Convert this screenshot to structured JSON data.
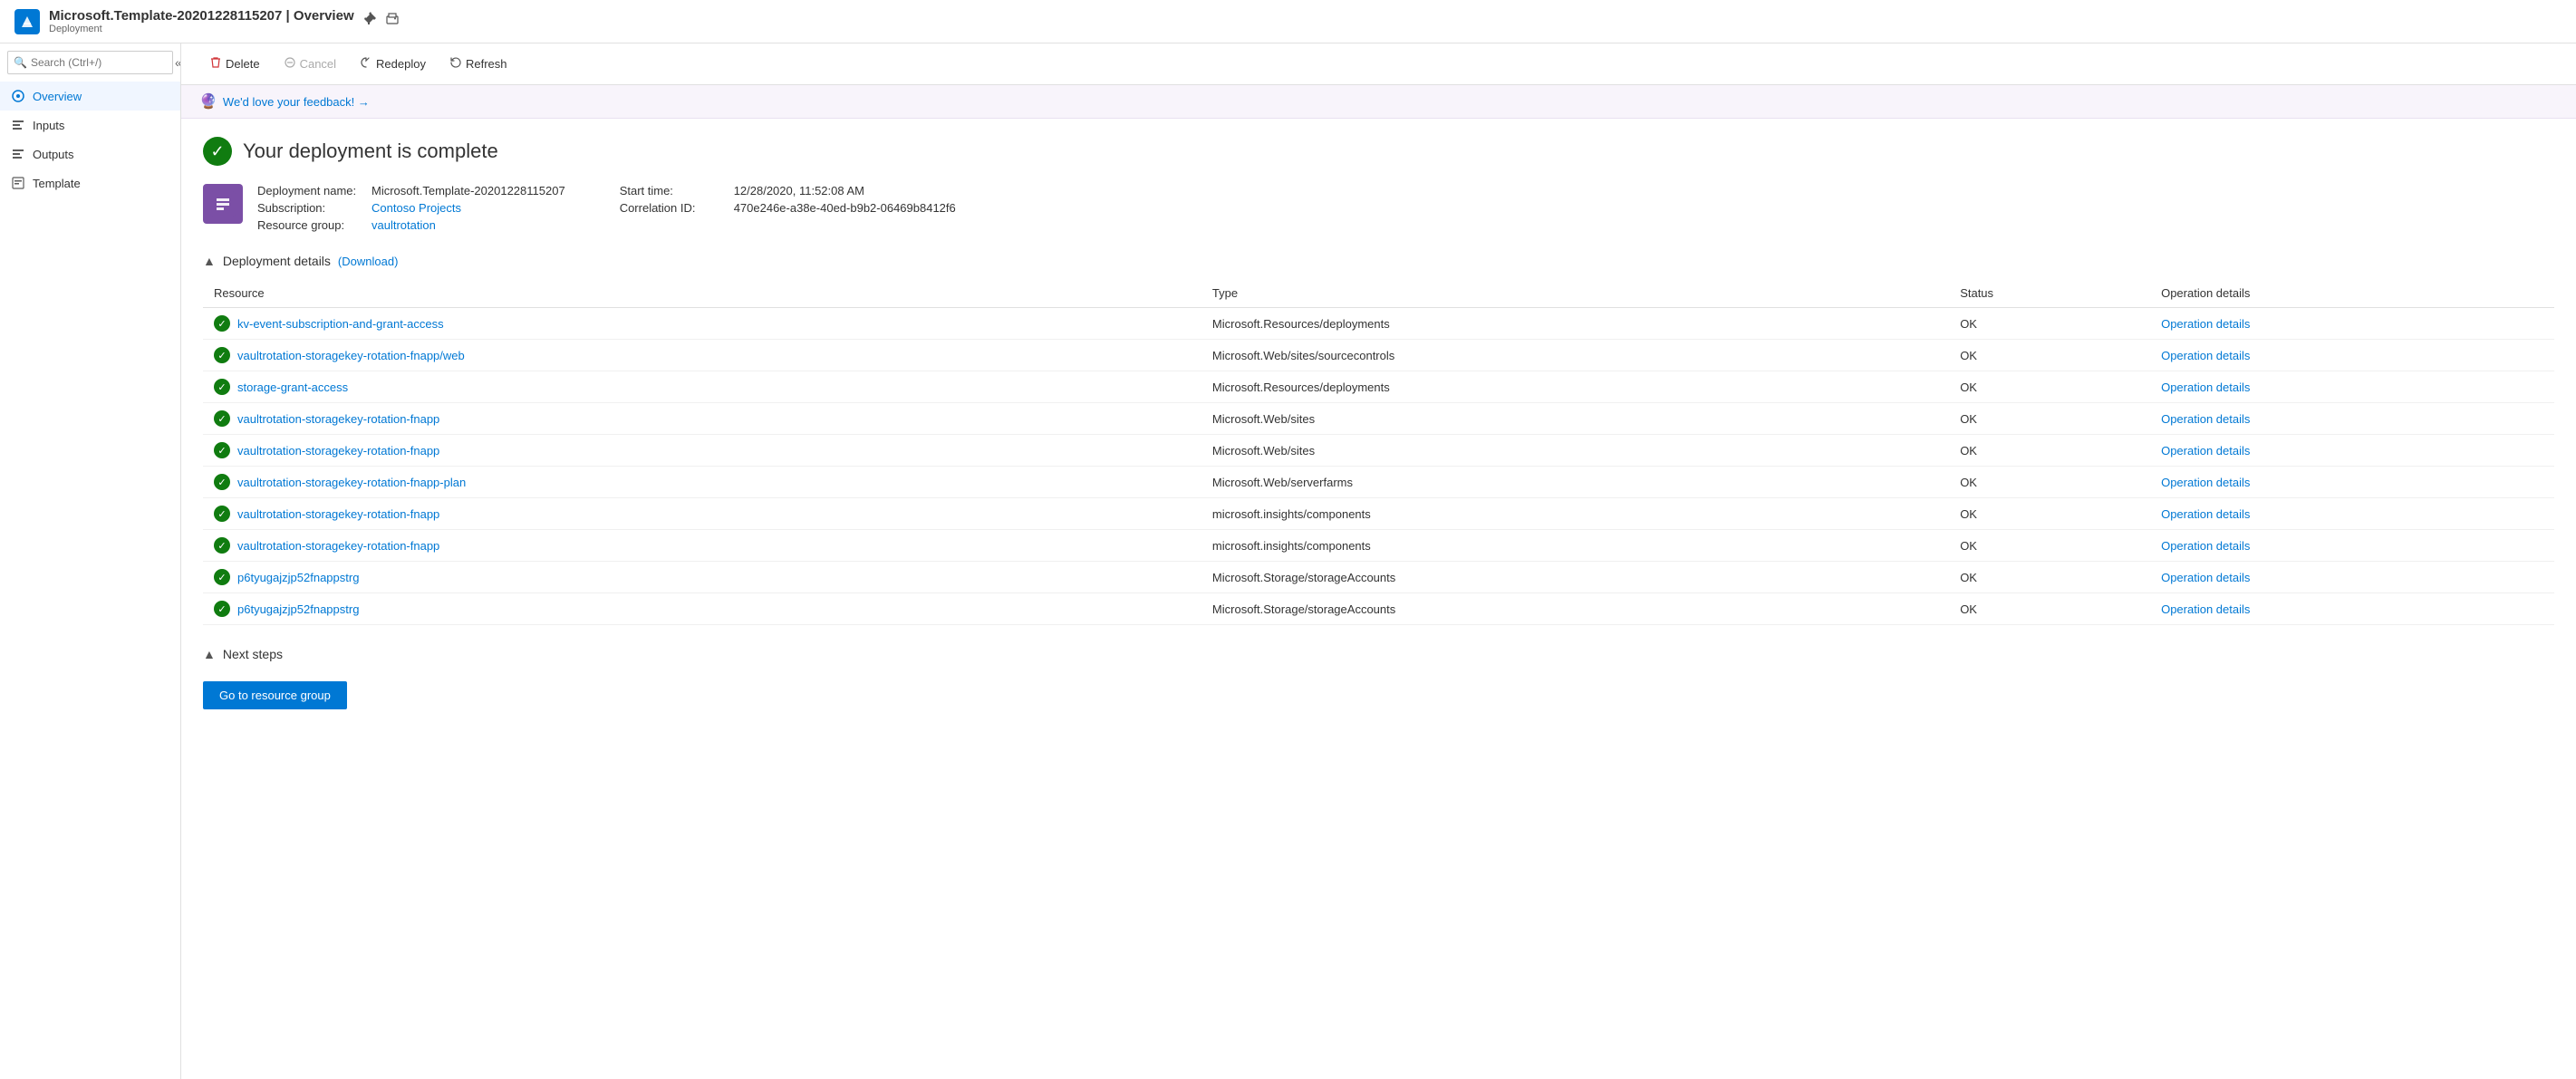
{
  "header": {
    "title": "Microsoft.Template-20201228115207 | Overview",
    "subtitle": "Deployment",
    "icon_pin": "📌",
    "icon_print": "🖨"
  },
  "search": {
    "placeholder": "Search (Ctrl+/)"
  },
  "toolbar": {
    "delete_label": "Delete",
    "cancel_label": "Cancel",
    "redeploy_label": "Redeploy",
    "refresh_label": "Refresh"
  },
  "feedback": {
    "text": "We'd love your feedback! →"
  },
  "nav": {
    "items": [
      {
        "id": "overview",
        "label": "Overview",
        "active": true
      },
      {
        "id": "inputs",
        "label": "Inputs",
        "active": false
      },
      {
        "id": "outputs",
        "label": "Outputs",
        "active": false
      },
      {
        "id": "template",
        "label": "Template",
        "active": false
      }
    ]
  },
  "deployment": {
    "status_title": "Your deployment is complete",
    "name_label": "Deployment name:",
    "name_value": "Microsoft.Template-20201228115207",
    "subscription_label": "Subscription:",
    "subscription_value": "Contoso Projects",
    "resource_group_label": "Resource group:",
    "resource_group_value": "vaultrotation",
    "start_time_label": "Start time:",
    "start_time_value": "12/28/2020, 11:52:08 AM",
    "correlation_label": "Correlation ID:",
    "correlation_value": "470e246e-a38e-40ed-b9b2-06469b8412f6"
  },
  "details": {
    "section_label": "Deployment details",
    "download_label": "(Download)",
    "columns": {
      "resource": "Resource",
      "type": "Type",
      "status": "Status",
      "operation_details": "Operation details"
    },
    "rows": [
      {
        "resource": "kv-event-subscription-and-grant-access",
        "type": "Microsoft.Resources/deployments",
        "status": "OK",
        "op": "Operation details"
      },
      {
        "resource": "vaultrotation-storagekey-rotation-fnapp/web",
        "type": "Microsoft.Web/sites/sourcecontrols",
        "status": "OK",
        "op": "Operation details"
      },
      {
        "resource": "storage-grant-access",
        "type": "Microsoft.Resources/deployments",
        "status": "OK",
        "op": "Operation details"
      },
      {
        "resource": "vaultrotation-storagekey-rotation-fnapp",
        "type": "Microsoft.Web/sites",
        "status": "OK",
        "op": "Operation details"
      },
      {
        "resource": "vaultrotation-storagekey-rotation-fnapp",
        "type": "Microsoft.Web/sites",
        "status": "OK",
        "op": "Operation details"
      },
      {
        "resource": "vaultrotation-storagekey-rotation-fnapp-plan",
        "type": "Microsoft.Web/serverfarms",
        "status": "OK",
        "op": "Operation details"
      },
      {
        "resource": "vaultrotation-storagekey-rotation-fnapp",
        "type": "microsoft.insights/components",
        "status": "OK",
        "op": "Operation details"
      },
      {
        "resource": "vaultrotation-storagekey-rotation-fnapp",
        "type": "microsoft.insights/components",
        "status": "OK",
        "op": "Operation details"
      },
      {
        "resource": "p6tyugajzjp52fnappstrg",
        "type": "Microsoft.Storage/storageAccounts",
        "status": "OK",
        "op": "Operation details"
      },
      {
        "resource": "p6tyugajzjp52fnappstrg",
        "type": "Microsoft.Storage/storageAccounts",
        "status": "OK",
        "op": "Operation details"
      }
    ]
  },
  "next_steps": {
    "section_label": "Next steps",
    "go_button_label": "Go to resource group"
  }
}
